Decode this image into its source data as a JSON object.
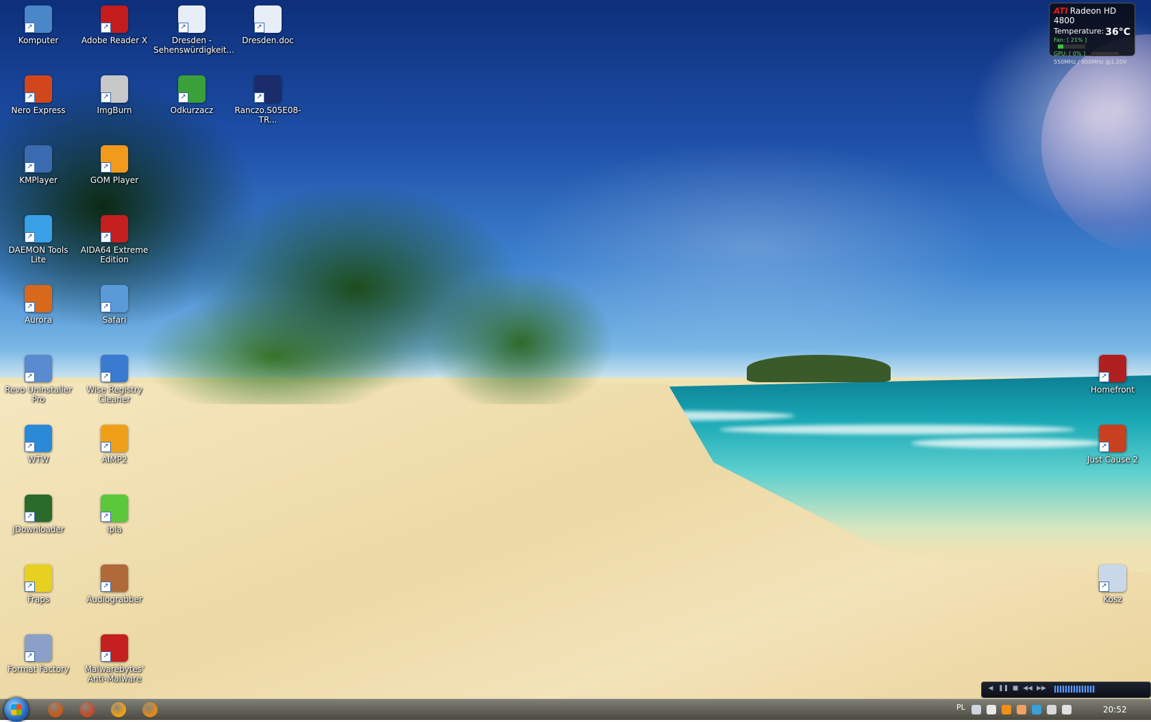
{
  "desktop_icons_left": [
    {
      "label": "Komputer",
      "icon": "computer-icon",
      "color": "#4a87c8"
    },
    {
      "label": "Adobe Reader X",
      "icon": "adobe-reader-icon",
      "color": "#c41c1c"
    },
    {
      "label": "Dresden - Sehenswürdigkeit...",
      "icon": "word-document-icon",
      "color": "#e8eef8"
    },
    {
      "label": "Dresden.doc",
      "icon": "word-document-icon",
      "color": "#e8eef8"
    },
    {
      "label": "Nero Express",
      "icon": "nero-icon",
      "color": "#d2461c"
    },
    {
      "label": "ImgBurn",
      "icon": "imgburn-disc-icon",
      "color": "#c8c8c8"
    },
    {
      "label": "Odkurzacz",
      "icon": "vacuum-cleaner-icon",
      "color": "#3aa03a"
    },
    {
      "label": "Ranczo.S05E08-TR...",
      "icon": "video-file-icon",
      "color": "#1a2c6a"
    },
    {
      "label": "KMPlayer",
      "icon": "kmplayer-icon",
      "color": "#3a6ab0"
    },
    {
      "label": "GOM Player",
      "icon": "gom-player-icon",
      "color": "#f29a1c"
    },
    {
      "label": "DAEMON Tools Lite",
      "icon": "daemon-tools-icon",
      "color": "#3aa0e8"
    },
    {
      "label": "AIDA64 Extreme Edition",
      "icon": "aida64-icon",
      "color": "#c42020"
    },
    {
      "label": "Aurora",
      "icon": "aurora-browser-icon",
      "color": "#d8681c"
    },
    {
      "label": "Safari",
      "icon": "safari-compass-icon",
      "color": "#5a9ad8"
    },
    {
      "label": "Revo Uninstaller Pro",
      "icon": "revo-uninstaller-icon",
      "color": "#5a8ad0"
    },
    {
      "label": "Wise Registry Cleaner",
      "icon": "wise-registry-icon",
      "color": "#3a7ad0"
    },
    {
      "label": "WTW",
      "icon": "wtw-icon",
      "color": "#2a8ad8"
    },
    {
      "label": "AIMP2",
      "icon": "aimp-icon",
      "color": "#f0a018"
    },
    {
      "label": "JDownloader",
      "icon": "jdownloader-icon",
      "color": "#2a6a2a"
    },
    {
      "label": "ipla",
      "icon": "ipla-icon",
      "color": "#5ac83a"
    },
    {
      "label": "Fraps",
      "icon": "fraps-icon",
      "color": "#e8d020"
    },
    {
      "label": "Audiograbber",
      "icon": "audiograbber-icon",
      "color": "#b06a3a"
    },
    {
      "label": "Format Factory",
      "icon": "format-factory-icon",
      "color": "#8aa0c8"
    },
    {
      "label": "Malwarebytes' Anti-Malware",
      "icon": "malwarebytes-icon",
      "color": "#c42020"
    }
  ],
  "desktop_icons_right": [
    {
      "label": "Homefront",
      "icon": "homefront-game-icon",
      "color": "#b02020"
    },
    {
      "label": "Just Cause 2",
      "icon": "just-cause-2-icon",
      "color": "#c84020"
    },
    {
      "label": "Kosz",
      "icon": "recycle-bin-icon",
      "color": "#c8d8e8"
    }
  ],
  "ati_gadget": {
    "brand": "ATI",
    "model": "Radeon HD 4800",
    "temp_label": "Temperature:",
    "temp_value": "36°C",
    "fan": "Fan: [ 21% ]",
    "fan_level": 0.21,
    "gpu": "GPU: [ 0% ]",
    "gpu_level": 0.0,
    "clocks": "550MHz / 900MHz @1.20V"
  },
  "taskbar": {
    "language": "PL",
    "clock": "20:52",
    "pinned": [
      {
        "name": "aurora-taskbar-icon",
        "color": "#c85a1c"
      },
      {
        "name": "nero-taskbar-icon",
        "color": "#c84a2a"
      },
      {
        "name": "aimp-taskbar-icon",
        "color": "#f0a018"
      },
      {
        "name": "audio-taskbar-icon",
        "color": "#e08a1a"
      }
    ],
    "tray": [
      {
        "name": "keyboard-tray-icon",
        "color": "#cfd6df"
      },
      {
        "name": "show-hidden-icons-arrow",
        "color": "#e8e8e8"
      },
      {
        "name": "aimp-tray-icon",
        "color": "#f09018"
      },
      {
        "name": "volume-tray-icon",
        "color": "#f0a060"
      },
      {
        "name": "network-monitor-tray-icon",
        "color": "#3aa0d8"
      },
      {
        "name": "power-tray-icon",
        "color": "#d8d8d8"
      },
      {
        "name": "speaker-tray-icon",
        "color": "#e0e0e0"
      }
    ]
  }
}
